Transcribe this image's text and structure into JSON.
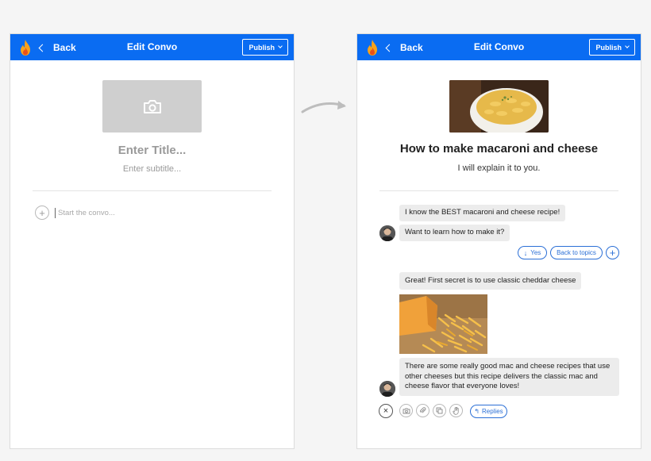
{
  "left_screen": {
    "topbar": {
      "back_label": "Back",
      "title": "Edit Convo",
      "publish_label": "Publish"
    },
    "title_placeholder": "Enter Title...",
    "subtitle_placeholder": "Enter subtitle...",
    "start_placeholder": "Start the convo..."
  },
  "right_screen": {
    "topbar": {
      "back_label": "Back",
      "title": "Edit Convo",
      "publish_label": "Publish"
    },
    "title": "How to make macaroni and cheese",
    "subtitle": "I will explain it to you.",
    "messages": [
      "I know the BEST macaroni and cheese recipe!",
      "Want to learn how to make it?",
      "Great! First secret is to use classic cheddar cheese",
      "There are some really good mac and cheese recipes that use other cheeses but this recipe delivers the classic mac and cheese flavor that everyone loves!"
    ],
    "reply_buttons": {
      "yes": "Yes",
      "back_to_topics": "Back to topics"
    },
    "toolbar": {
      "replies": "Replies"
    }
  },
  "colors": {
    "brand_blue": "#0a6cf2",
    "link_blue": "#2b6fd6",
    "bubble_bg": "#ececec"
  }
}
